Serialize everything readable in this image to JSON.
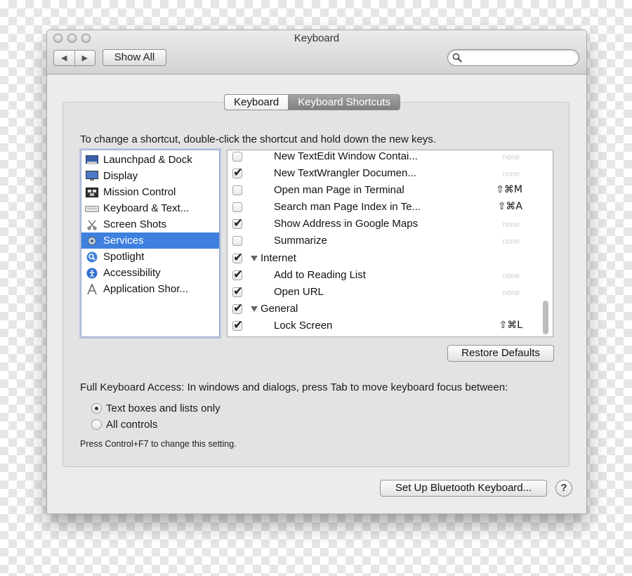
{
  "window": {
    "title": "Keyboard"
  },
  "toolbar": {
    "back_icon": "left-arrow-icon",
    "forward_icon": "right-arrow-icon",
    "show_all_label": "Show All",
    "search_placeholder": "",
    "search_value": ""
  },
  "tabs": [
    {
      "label": "Keyboard",
      "active": true
    },
    {
      "label": "Keyboard Shortcuts",
      "active": false
    }
  ],
  "instruction": "To change a shortcut, double-click the shortcut and hold down the new keys.",
  "categories": [
    {
      "label": "Launchpad & Dock",
      "icon": "launchpad-dock-icon",
      "selected": false
    },
    {
      "label": "Display",
      "icon": "display-icon",
      "selected": false
    },
    {
      "label": "Mission Control",
      "icon": "mission-control-icon",
      "selected": false
    },
    {
      "label": "Keyboard & Text...",
      "icon": "keyboard-icon",
      "selected": false
    },
    {
      "label": "Screen Shots",
      "icon": "screenshot-icon",
      "selected": false
    },
    {
      "label": "Services",
      "icon": "gear-icon",
      "selected": true
    },
    {
      "label": "Spotlight",
      "icon": "spotlight-icon",
      "selected": false
    },
    {
      "label": "Accessibility",
      "icon": "accessibility-icon",
      "selected": false
    },
    {
      "label": "Application Shor...",
      "icon": "app-shortcuts-icon",
      "selected": false
    }
  ],
  "shortcuts": [
    {
      "label": "New TextEdit Window Contai...",
      "checked": false,
      "keys": "",
      "none_text": "none"
    },
    {
      "label": "New TextWrangler Documen...",
      "checked": true,
      "keys": "",
      "none_text": "none"
    },
    {
      "label": "Open man Page in Terminal",
      "checked": false,
      "keys": "⇧⌘M",
      "none_text": ""
    },
    {
      "label": "Search man Page Index in Te...",
      "checked": false,
      "keys": "⇧⌘A",
      "none_text": ""
    },
    {
      "label": "Show Address in Google Maps",
      "checked": true,
      "keys": "",
      "none_text": "none"
    },
    {
      "label": "Summarize",
      "checked": false,
      "keys": "",
      "none_text": "none"
    },
    {
      "label": "Internet",
      "checked": true,
      "group": true,
      "keys": "",
      "none_text": ""
    },
    {
      "label": "Add to Reading List",
      "checked": true,
      "keys": "",
      "none_text": "none"
    },
    {
      "label": "Open URL",
      "checked": true,
      "keys": "",
      "none_text": "none"
    },
    {
      "label": "General",
      "checked": true,
      "group": true,
      "keys": "",
      "none_text": ""
    },
    {
      "label": "Lock Screen",
      "checked": true,
      "keys": "⇧⌘L",
      "none_text": ""
    }
  ],
  "restore_defaults_label": "Restore Defaults",
  "full_keyboard_access": {
    "label": "Full Keyboard Access: In windows and dialogs, press Tab to move keyboard focus between:",
    "options": [
      {
        "label": "Text boxes and lists only",
        "selected": true
      },
      {
        "label": "All controls",
        "selected": false
      }
    ],
    "hint": "Press Control+F7 to change this setting."
  },
  "bluetooth_button_label": "Set Up Bluetooth Keyboard...",
  "help_label": "?"
}
